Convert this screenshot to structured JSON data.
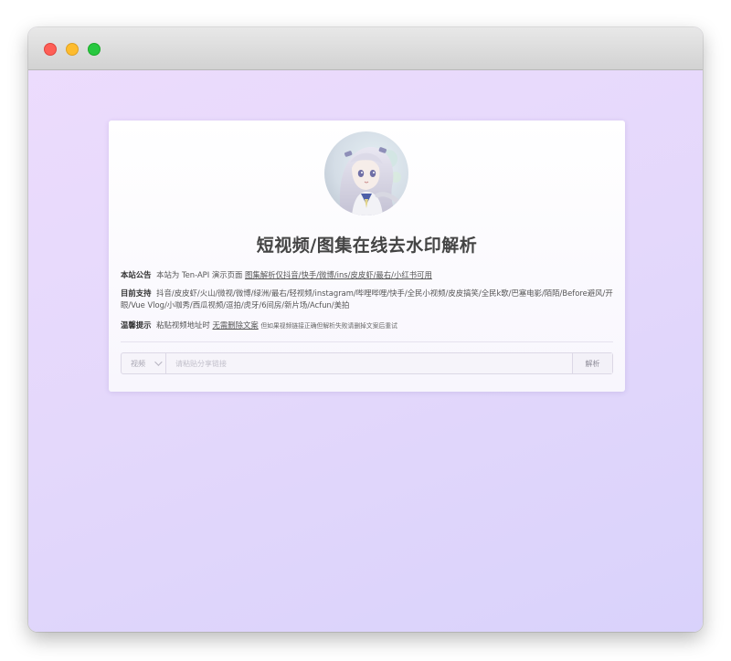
{
  "page": {
    "title": "短视频/图集在线去水印解析"
  },
  "notice": {
    "label": "本站公告",
    "text": "本站为 Ten-API 演示页面",
    "link": "图集解析仅抖音/快手/微博/ins/皮皮虾/最右/小红书可用"
  },
  "support": {
    "label": "目前支持",
    "text_line1": "抖音/皮皮虾/火山/微视/微博/绿洲/最右/轻视频/instagram/哔哩哔哩/快手/全民小视频/皮皮搞笑/全民k歌/巴塞电影/陌陌/Before避风/开",
    "text_line2": "眼/Vue Vlog/小咖秀/西瓜视频/逗拍/虎牙/6间房/新片场/Acfun/美拍"
  },
  "tip": {
    "label": "温馨提示",
    "text": "粘贴视频地址时",
    "link": "无需删除文案",
    "small": "但如果视频链接正确但解析失败请删掉文案后重试"
  },
  "search": {
    "type_value": "视频",
    "placeholder": "请粘贴分享链接",
    "submit_label": "解析"
  },
  "colors": {
    "background_start": "#eddcfd",
    "background_end": "#d9d2fb",
    "title": "#444444"
  }
}
